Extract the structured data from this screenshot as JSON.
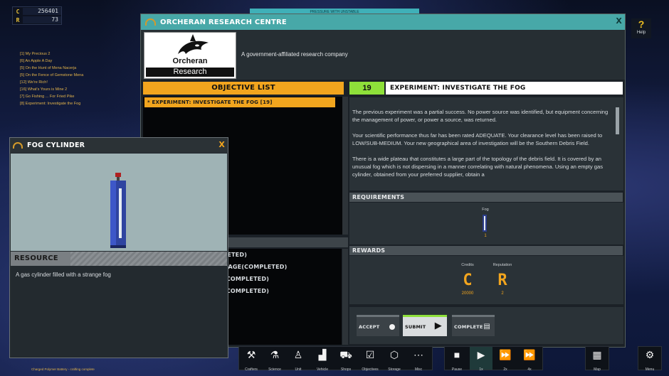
{
  "resources": {
    "credits_letter": "C",
    "credits_value": "256401",
    "reputation_letter": "R",
    "reputation_value": "73"
  },
  "top_banner": "PRESSURE WITH UNSTABLE",
  "quest_log": [
    "[1] My Precious 2",
    "[6] An Apple A Day",
    "[5] On the Hunt of Mena Nacerja",
    "[5] On the Fence of Gemstone Mena",
    "[12] We're Rich!",
    "[16] What's Yours is Mine 2",
    "[7] Go Fishing ... For Fried Pike",
    "[8] Experiment: Investigate the Fog"
  ],
  "help": {
    "icon": "?",
    "label": "Help"
  },
  "research_window": {
    "title": "ORCHERAN RESEARCH CENTRE",
    "close": "X",
    "logo_line1": "Orcheran",
    "logo_line2": "Research",
    "description": "A government-affiliated research company",
    "objective_list_title": "OBJECTIVE LIST",
    "objective_number": "19",
    "experiment_title": "EXPERIMENT: INVESTIGATE THE FOG",
    "objectives": [
      "* EXPERIMENT: INVESTIGATE THE FOG [19]"
    ],
    "completed": [
      "PLETED)",
      "CKAGE(COMPLETED)",
      "S(COMPLETED)",
      "S(COMPLETED)"
    ],
    "experiment_paragraphs": [
      "The previous experiment was a partial success. No power source was identified, but equipment concerning the management of power, or power a source, was returned.",
      "Your scientific performance thus far has been rated ADEQUATE. Your clearance level has been raised to LOW/SUB-MEDIUM. Your new geographical area of investigation will be the Southern Debris Field.",
      "There is a wide plateau that constitutes a large part of the topology of the debris field. It is covered by an unusual fog which is not dispersing in a manner correlating with natural phenomena. Using an empty gas cylinder, obtained from your preferred supplier, obtain a"
    ],
    "requirements_title": "REQUIREMENTS",
    "requirement": {
      "label": "Fog",
      "count": "1"
    },
    "rewards_title": "REWARDS",
    "rewards": [
      {
        "label": "Credits",
        "letter": "C",
        "value": "20000"
      },
      {
        "label": "Reputation",
        "letter": "R",
        "value": "2"
      }
    ],
    "buttons": {
      "accept": "ACCEPT",
      "submit": "SUBMIT",
      "complete": "COMPLETE"
    }
  },
  "fog_window": {
    "title": "FOG CYLINDER",
    "close": "X",
    "resource_title": "RESOURCE",
    "resource_description": "A gas cylinder filled with a strange fog"
  },
  "toolbar": {
    "left": [
      {
        "icon": "crafters-icon",
        "glyph": "⚒",
        "label": "Crafters"
      },
      {
        "icon": "science-icon",
        "glyph": "⚗",
        "label": "Science"
      },
      {
        "icon": "unit-icon",
        "glyph": "♙",
        "label": "Unit"
      },
      {
        "icon": "vehicle-icon",
        "glyph": "▟",
        "label": "Vehicle"
      },
      {
        "icon": "shops-icon",
        "glyph": "⛟",
        "label": "Shops"
      },
      {
        "icon": "objectives-icon",
        "glyph": "☑",
        "label": "Objectives"
      },
      {
        "icon": "storage-icon",
        "glyph": "⬡",
        "label": "Storage"
      },
      {
        "icon": "misc-icon",
        "glyph": "⋯",
        "label": "Misc"
      }
    ],
    "speed": [
      {
        "icon": "pause-icon",
        "glyph": "■",
        "label": "Pause"
      },
      {
        "icon": "play-1x-icon",
        "glyph": "▶",
        "label": "1x"
      },
      {
        "icon": "play-2x-icon",
        "glyph": "⏩",
        "label": "2x"
      },
      {
        "icon": "play-4x-icon",
        "glyph": "⏩",
        "label": "4x"
      }
    ],
    "map": {
      "icon": "map-icon",
      "glyph": "▦",
      "label": "Map"
    },
    "menu": {
      "icon": "gear-icon",
      "glyph": "⚙",
      "label": "Menu"
    }
  },
  "bottom_status": "Charged Polymer Battery - crafting complete"
}
